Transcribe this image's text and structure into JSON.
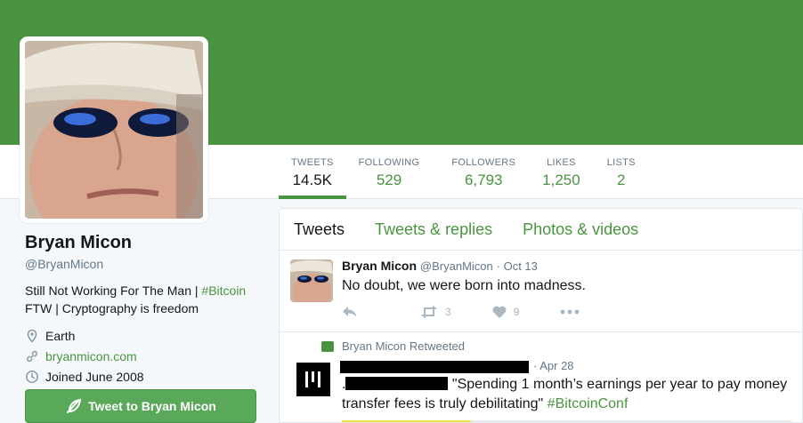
{
  "banner_color": "#4a9441",
  "profile": {
    "name": "Bryan Micon",
    "handle": "@BryanMicon",
    "bio_part1": "Still Not Working For The Man | ",
    "bio_tag": "#Bitcoin",
    "bio_part2": "FTW | Cryptography is freedom",
    "location": "Earth",
    "url": "bryanmicon.com",
    "joined": "Joined June 2008",
    "tweet_to_label": "Tweet to Bryan Micon"
  },
  "stats": [
    {
      "label": "TWEETS",
      "value": "14.5K"
    },
    {
      "label": "FOLLOWING",
      "value": "529"
    },
    {
      "label": "FOLLOWERS",
      "value": "6,793"
    },
    {
      "label": "LIKES",
      "value": "1,250"
    },
    {
      "label": "LISTS",
      "value": "2"
    }
  ],
  "tabs": [
    "Tweets",
    "Tweets & replies",
    "Photos & videos"
  ],
  "tweets": [
    {
      "name": "Bryan Micon",
      "handle": "@BryanMicon",
      "time": "· Oct 13",
      "text": "No doubt, we were born into madness.",
      "retweets": "3",
      "likes": "9"
    },
    {
      "context": "Bryan Micon Retweeted",
      "time": "· Apr 28",
      "text_lead": ".",
      "text_main": " \"Spending 1 month’s earnings per year to pay money transfer fees is truly debilitating\" ",
      "text_tag": "#BitcoinConf"
    }
  ]
}
